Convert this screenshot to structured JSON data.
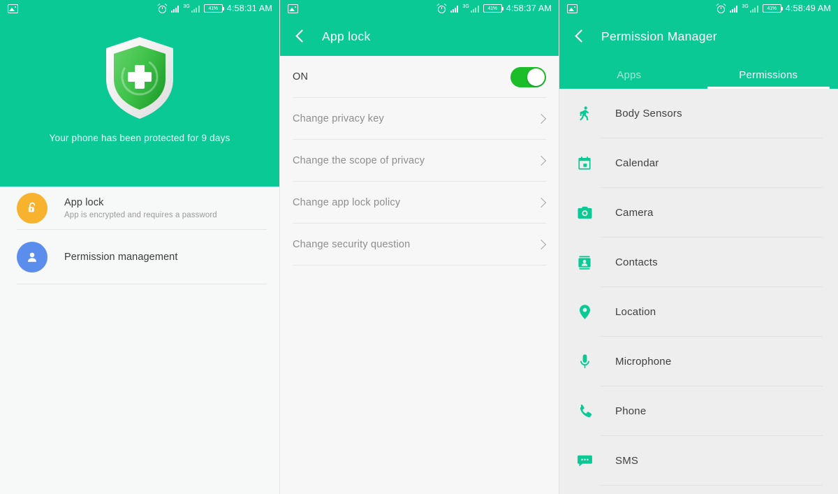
{
  "statusbar": {
    "photo_icon": "photo-icon",
    "alarm_icon": "alarm-icon",
    "signal_icon": "signal-bars-icon",
    "network_label": "3G",
    "battery_text": "41%",
    "times": [
      "4:58:31 AM",
      "4:58:37 AM",
      "4:58:49 AM"
    ]
  },
  "panel1": {
    "hero": {
      "shield_icon": "shield-plus-icon",
      "status_text": "Your phone has been protected for 9 days"
    },
    "items": [
      {
        "icon": "unlocked-padlock-icon",
        "icon_color": "#f7b22e",
        "title": "App lock",
        "subtitle": "App is encrypted and requires a password"
      },
      {
        "icon": "person-icon",
        "icon_color": "#5b8ded",
        "title": "Permission management",
        "subtitle": ""
      }
    ]
  },
  "panel2": {
    "back_icon": "back-chevron-icon",
    "title": "App lock",
    "toggle": {
      "label": "ON",
      "state": "on",
      "color": "#1bbd28"
    },
    "items": [
      {
        "label": "Change privacy key",
        "chevron": "chevron-right-icon"
      },
      {
        "label": "Change the scope of privacy",
        "chevron": "chevron-right-icon"
      },
      {
        "label": "Change app lock policy",
        "chevron": "chevron-right-icon"
      },
      {
        "label": "Change security question",
        "chevron": "chevron-right-icon"
      }
    ]
  },
  "panel3": {
    "back_icon": "back-chevron-icon",
    "title": "Permission Manager",
    "tabs": [
      {
        "label": "Apps",
        "active": false
      },
      {
        "label": "Permissions",
        "active": true
      }
    ],
    "permissions": [
      {
        "label": "Body Sensors",
        "icon": "running-person-icon"
      },
      {
        "label": "Calendar",
        "icon": "calendar-icon"
      },
      {
        "label": "Camera",
        "icon": "camera-icon"
      },
      {
        "label": "Contacts",
        "icon": "contact-card-icon"
      },
      {
        "label": "Location",
        "icon": "location-pin-icon"
      },
      {
        "label": "Microphone",
        "icon": "microphone-icon"
      },
      {
        "label": "Phone",
        "icon": "phone-handset-icon"
      },
      {
        "label": "SMS",
        "icon": "sms-bubble-icon"
      }
    ]
  },
  "colors": {
    "accent_teal": "#0ac995",
    "icon_green": "#0ac995",
    "toggle_green": "#1bbd28",
    "panel1_bg": "#f7f8f8",
    "panel3_bg": "#eeeeee"
  }
}
